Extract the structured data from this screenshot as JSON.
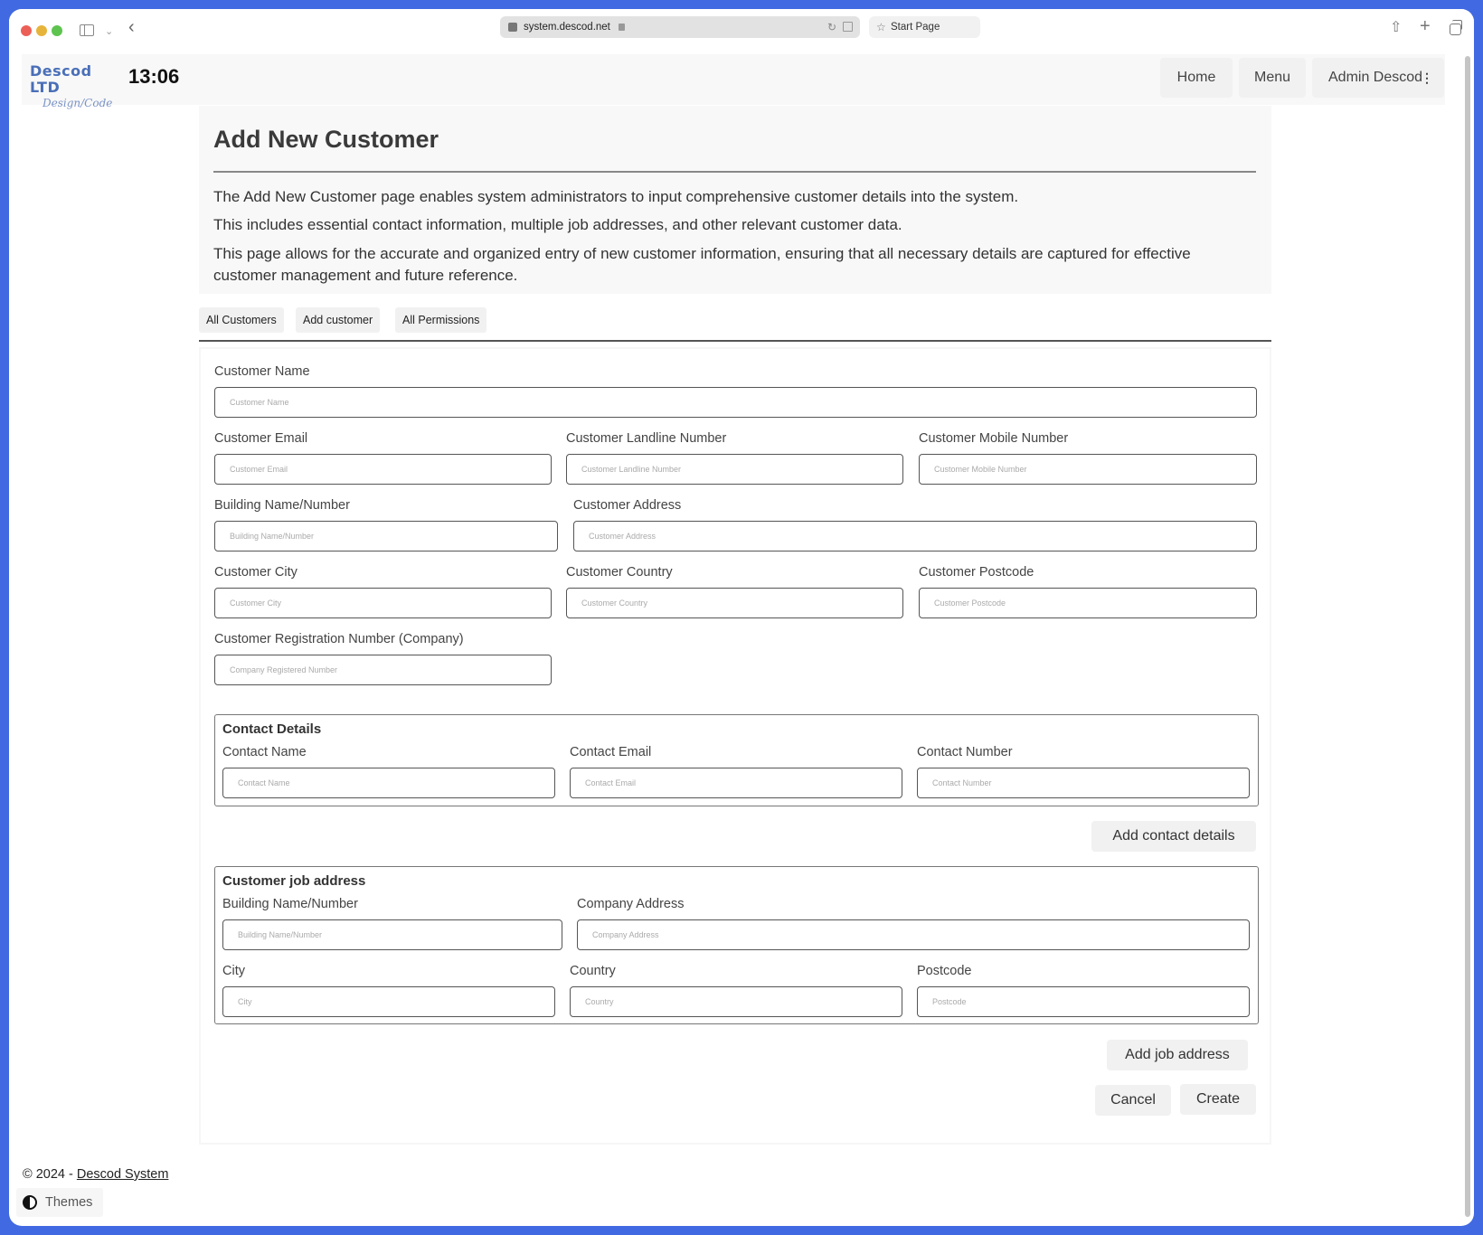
{
  "browser": {
    "url": "system.descod.net",
    "start_page_label": "Start Page"
  },
  "header": {
    "logo_main": "Descod LTD",
    "logo_sub": "Design/Code",
    "clock": "13:06",
    "nav": {
      "home": "Home",
      "menu": "Menu",
      "user": "Admin Descod"
    }
  },
  "intro": {
    "title": "Add New Customer",
    "paragraphs": [
      "The Add New Customer page enables system administrators to input comprehensive customer details into the system.",
      "This includes essential contact information, multiple job addresses, and other relevant customer data.",
      "This page allows for the accurate and organized entry of new customer information, ensuring that all necessary details are captured for effective customer management and future reference."
    ]
  },
  "subnav": [
    "All Customers",
    "Add customer",
    "All Permissions"
  ],
  "form": {
    "customer_name": {
      "label": "Customer Name",
      "placeholder": "Customer Name",
      "value": ""
    },
    "customer_email": {
      "label": "Customer Email",
      "placeholder": "Customer Email",
      "value": ""
    },
    "customer_landline": {
      "label": "Customer Landline Number",
      "placeholder": "Customer Landline Number",
      "value": ""
    },
    "customer_mobile": {
      "label": "Customer Mobile Number",
      "placeholder": "Customer Mobile Number",
      "value": ""
    },
    "building": {
      "label": "Building Name/Number",
      "placeholder": "Building Name/Number",
      "value": ""
    },
    "customer_address": {
      "label": "Customer Address",
      "placeholder": "Customer Address",
      "value": ""
    },
    "customer_city": {
      "label": "Customer City",
      "placeholder": "Customer City",
      "value": ""
    },
    "customer_country": {
      "label": "Customer Country",
      "placeholder": "Customer Country",
      "value": ""
    },
    "customer_postcode": {
      "label": "Customer Postcode",
      "placeholder": "Customer Postcode",
      "value": ""
    },
    "registration_number": {
      "label": "Customer Registration Number (Company)",
      "placeholder": "Company Registered Number",
      "value": ""
    }
  },
  "contact_details": {
    "title": "Contact Details",
    "contact_name": {
      "label": "Contact Name",
      "placeholder": "Contact Name"
    },
    "contact_email": {
      "label": "Contact Email",
      "placeholder": "Contact Email"
    },
    "contact_number": {
      "label": "Contact Number",
      "placeholder": "Contact Number"
    },
    "add_button": "Add contact details"
  },
  "job_address": {
    "title": "Customer job address",
    "building": {
      "label": "Building Name/Number",
      "placeholder": "Building Name/Number"
    },
    "company_address": {
      "label": "Company Address",
      "placeholder": "Company Address"
    },
    "city": {
      "label": "City",
      "placeholder": "City"
    },
    "country": {
      "label": "Country",
      "placeholder": "Country"
    },
    "postcode": {
      "label": "Postcode",
      "placeholder": "Postcode"
    },
    "add_button": "Add job address"
  },
  "actions": {
    "cancel": "Cancel",
    "create": "Create"
  },
  "footer": {
    "copyright": "© 2024 - ",
    "link": "Descod System",
    "themes": "Themes"
  }
}
